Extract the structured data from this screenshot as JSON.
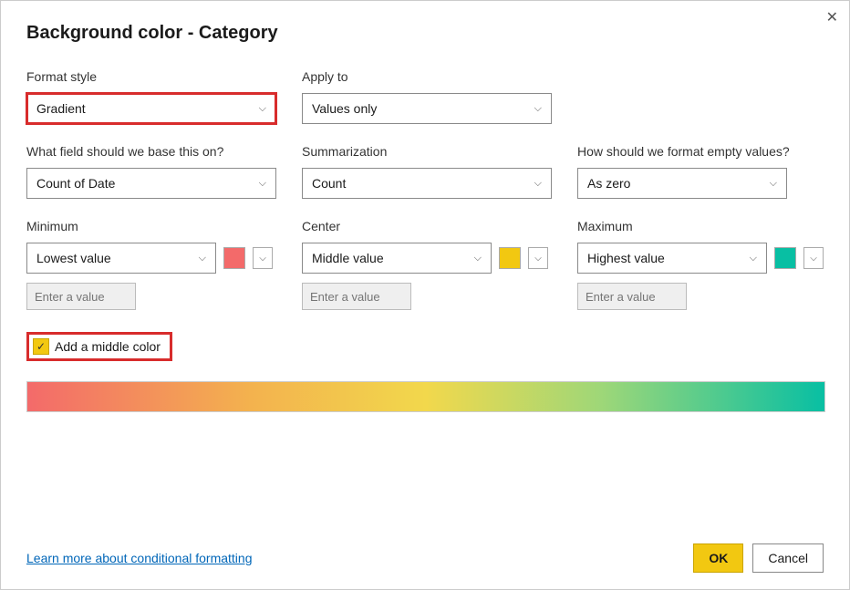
{
  "dialog": {
    "title": "Background color - Category",
    "close_symbol": "✕"
  },
  "formatStyle": {
    "label": "Format style",
    "value": "Gradient"
  },
  "applyTo": {
    "label": "Apply to",
    "value": "Values only"
  },
  "basisField": {
    "label": "What field should we base this on?",
    "value": "Count of Date"
  },
  "summarization": {
    "label": "Summarization",
    "value": "Count"
  },
  "emptyValues": {
    "label": "How should we format empty values?",
    "value": "As zero"
  },
  "minimum": {
    "label": "Minimum",
    "value": "Lowest value",
    "placeholder": "Enter a value",
    "color": "#f36a6a"
  },
  "center": {
    "label": "Center",
    "value": "Middle value",
    "placeholder": "Enter a value",
    "color": "#f2c811"
  },
  "maximum": {
    "label": "Maximum",
    "value": "Highest value",
    "placeholder": "Enter a value",
    "color": "#08bfa3"
  },
  "addMiddle": {
    "label": "Add a middle color",
    "checked": true
  },
  "footer": {
    "learn_more": "Learn more about conditional formatting",
    "ok": "OK",
    "cancel": "Cancel"
  }
}
